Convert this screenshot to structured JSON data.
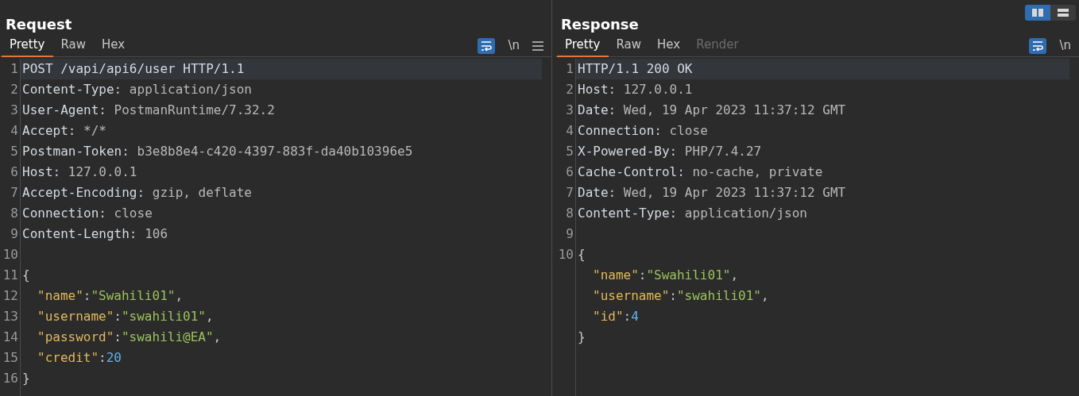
{
  "view_toggle": [
    {
      "kind": "columns",
      "selected": true
    },
    {
      "kind": "rows",
      "selected": false
    }
  ],
  "panels": [
    {
      "title": "Request",
      "tabs": [
        {
          "label": "Pretty",
          "selected": true,
          "disabled": false
        },
        {
          "label": "Raw",
          "selected": false,
          "disabled": false
        },
        {
          "label": "Hex",
          "selected": false,
          "disabled": false
        }
      ],
      "tools": [
        {
          "kind": "wrap",
          "on": true
        },
        {
          "kind": "text",
          "label": "\\n"
        },
        {
          "kind": "menu"
        }
      ],
      "lines": [
        {
          "number": "1",
          "current": true,
          "tokens": [
            {
              "kind": "plain",
              "text": "POST /vapi/api6/user HTTP/1.1"
            }
          ]
        },
        {
          "number": "2",
          "current": false,
          "tokens": [
            {
              "kind": "header_name",
              "text": "Content-Type"
            },
            {
              "kind": "punct",
              "text": ": "
            },
            {
              "kind": "header_value",
              "text": "application/json"
            }
          ]
        },
        {
          "number": "3",
          "current": false,
          "tokens": [
            {
              "kind": "header_name",
              "text": "User-Agent"
            },
            {
              "kind": "punct",
              "text": ": "
            },
            {
              "kind": "header_value",
              "text": "PostmanRuntime/7.32.2"
            }
          ]
        },
        {
          "number": "4",
          "current": false,
          "tokens": [
            {
              "kind": "header_name",
              "text": "Accept"
            },
            {
              "kind": "punct",
              "text": ": "
            },
            {
              "kind": "header_value",
              "text": "*/*"
            }
          ]
        },
        {
          "number": "5",
          "current": false,
          "tokens": [
            {
              "kind": "header_name",
              "text": "Postman-Token"
            },
            {
              "kind": "punct",
              "text": ": "
            },
            {
              "kind": "header_value",
              "text": "b3e8b8e4-c420-4397-883f-da40b10396e5"
            }
          ]
        },
        {
          "number": "6",
          "current": false,
          "tokens": [
            {
              "kind": "header_name",
              "text": "Host"
            },
            {
              "kind": "punct",
              "text": ": "
            },
            {
              "kind": "header_value",
              "text": "127.0.0.1"
            }
          ]
        },
        {
          "number": "7",
          "current": false,
          "tokens": [
            {
              "kind": "header_name",
              "text": "Accept-Encoding"
            },
            {
              "kind": "punct",
              "text": ": "
            },
            {
              "kind": "header_value",
              "text": "gzip, deflate"
            }
          ]
        },
        {
          "number": "8",
          "current": false,
          "tokens": [
            {
              "kind": "header_name",
              "text": "Connection"
            },
            {
              "kind": "punct",
              "text": ": "
            },
            {
              "kind": "header_value",
              "text": "close"
            }
          ]
        },
        {
          "number": "9",
          "current": false,
          "tokens": [
            {
              "kind": "header_name",
              "text": "Content-Length"
            },
            {
              "kind": "punct",
              "text": ": "
            },
            {
              "kind": "header_value",
              "text": "106"
            }
          ]
        },
        {
          "number": "10",
          "current": false
        },
        {
          "number": "11",
          "current": false,
          "tokens": [
            {
              "kind": "punct",
              "text": "{"
            }
          ]
        },
        {
          "number": "12",
          "current": false,
          "indent": true,
          "tokens": [
            {
              "kind": "key",
              "text": "\"name\""
            },
            {
              "kind": "punct",
              "text": ":"
            },
            {
              "kind": "string",
              "text": "\"Swahili01\""
            },
            {
              "kind": "punct",
              "text": ","
            }
          ]
        },
        {
          "number": "13",
          "current": false,
          "indent": true,
          "tokens": [
            {
              "kind": "key",
              "text": "\"username\""
            },
            {
              "kind": "punct",
              "text": ":"
            },
            {
              "kind": "string",
              "text": "\"swahili01\""
            },
            {
              "kind": "punct",
              "text": ","
            }
          ]
        },
        {
          "number": "14",
          "current": false,
          "indent": true,
          "tokens": [
            {
              "kind": "key",
              "text": "\"password\""
            },
            {
              "kind": "punct",
              "text": ":"
            },
            {
              "kind": "string",
              "text": "\"swahili@EA\""
            },
            {
              "kind": "punct",
              "text": ","
            }
          ]
        },
        {
          "number": "15",
          "current": false,
          "indent": true,
          "tokens": [
            {
              "kind": "key",
              "text": "\"credit\""
            },
            {
              "kind": "punct",
              "text": ":"
            },
            {
              "kind": "number",
              "text": "20"
            }
          ]
        },
        {
          "number": "16",
          "current": false,
          "tokens": [
            {
              "kind": "punct",
              "text": "}"
            }
          ]
        }
      ]
    },
    {
      "title": "Response",
      "tabs": [
        {
          "label": "Pretty",
          "selected": true,
          "disabled": false
        },
        {
          "label": "Raw",
          "selected": false,
          "disabled": false
        },
        {
          "label": "Hex",
          "selected": false,
          "disabled": false
        },
        {
          "label": "Render",
          "selected": false,
          "disabled": true
        }
      ],
      "tools": [
        {
          "kind": "wrap",
          "on": true
        },
        {
          "kind": "text",
          "label": "\\n"
        }
      ],
      "lines": [
        {
          "number": "1",
          "current": true,
          "tokens": [
            {
              "kind": "plain",
              "text": "HTTP/1.1 200 OK"
            }
          ]
        },
        {
          "number": "2",
          "current": false,
          "tokens": [
            {
              "kind": "header_name",
              "text": "Host"
            },
            {
              "kind": "punct",
              "text": ": "
            },
            {
              "kind": "header_value",
              "text": "127.0.0.1"
            }
          ]
        },
        {
          "number": "3",
          "current": false,
          "tokens": [
            {
              "kind": "header_name",
              "text": "Date"
            },
            {
              "kind": "punct",
              "text": ": "
            },
            {
              "kind": "header_value",
              "text": "Wed, 19 Apr 2023 11:37:12 GMT"
            }
          ]
        },
        {
          "number": "4",
          "current": false,
          "tokens": [
            {
              "kind": "header_name",
              "text": "Connection"
            },
            {
              "kind": "punct",
              "text": ": "
            },
            {
              "kind": "header_value",
              "text": "close"
            }
          ]
        },
        {
          "number": "5",
          "current": false,
          "tokens": [
            {
              "kind": "header_name",
              "text": "X-Powered-By"
            },
            {
              "kind": "punct",
              "text": ": "
            },
            {
              "kind": "header_value",
              "text": "PHP/7.4.27"
            }
          ]
        },
        {
          "number": "6",
          "current": false,
          "tokens": [
            {
              "kind": "header_name",
              "text": "Cache-Control"
            },
            {
              "kind": "punct",
              "text": ": "
            },
            {
              "kind": "header_value",
              "text": "no-cache, private"
            }
          ]
        },
        {
          "number": "7",
          "current": false,
          "tokens": [
            {
              "kind": "header_name",
              "text": "Date"
            },
            {
              "kind": "punct",
              "text": ": "
            },
            {
              "kind": "header_value",
              "text": "Wed, 19 Apr 2023 11:37:12 GMT"
            }
          ]
        },
        {
          "number": "8",
          "current": false,
          "tokens": [
            {
              "kind": "header_name",
              "text": "Content-Type"
            },
            {
              "kind": "punct",
              "text": ": "
            },
            {
              "kind": "header_value",
              "text": "application/json"
            }
          ]
        },
        {
          "number": "9",
          "current": false
        },
        {
          "number": "10",
          "current": false,
          "tokens": [
            {
              "kind": "punct",
              "text": "{"
            }
          ]
        },
        {
          "current": false,
          "indent": true,
          "tokens": [
            {
              "kind": "key",
              "text": "\"name\""
            },
            {
              "kind": "punct",
              "text": ":"
            },
            {
              "kind": "string",
              "text": "\"Swahili01\""
            },
            {
              "kind": "punct",
              "text": ","
            }
          ]
        },
        {
          "current": false,
          "indent": true,
          "tokens": [
            {
              "kind": "key",
              "text": "\"username\""
            },
            {
              "kind": "punct",
              "text": ":"
            },
            {
              "kind": "string",
              "text": "\"swahili01\""
            },
            {
              "kind": "punct",
              "text": ","
            }
          ]
        },
        {
          "current": false,
          "indent": true,
          "tokens": [
            {
              "kind": "key",
              "text": "\"id\""
            },
            {
              "kind": "punct",
              "text": ":"
            },
            {
              "kind": "number",
              "text": "4"
            }
          ]
        },
        {
          "current": false,
          "tokens": [
            {
              "kind": "punct",
              "text": "}"
            }
          ]
        }
      ]
    }
  ]
}
